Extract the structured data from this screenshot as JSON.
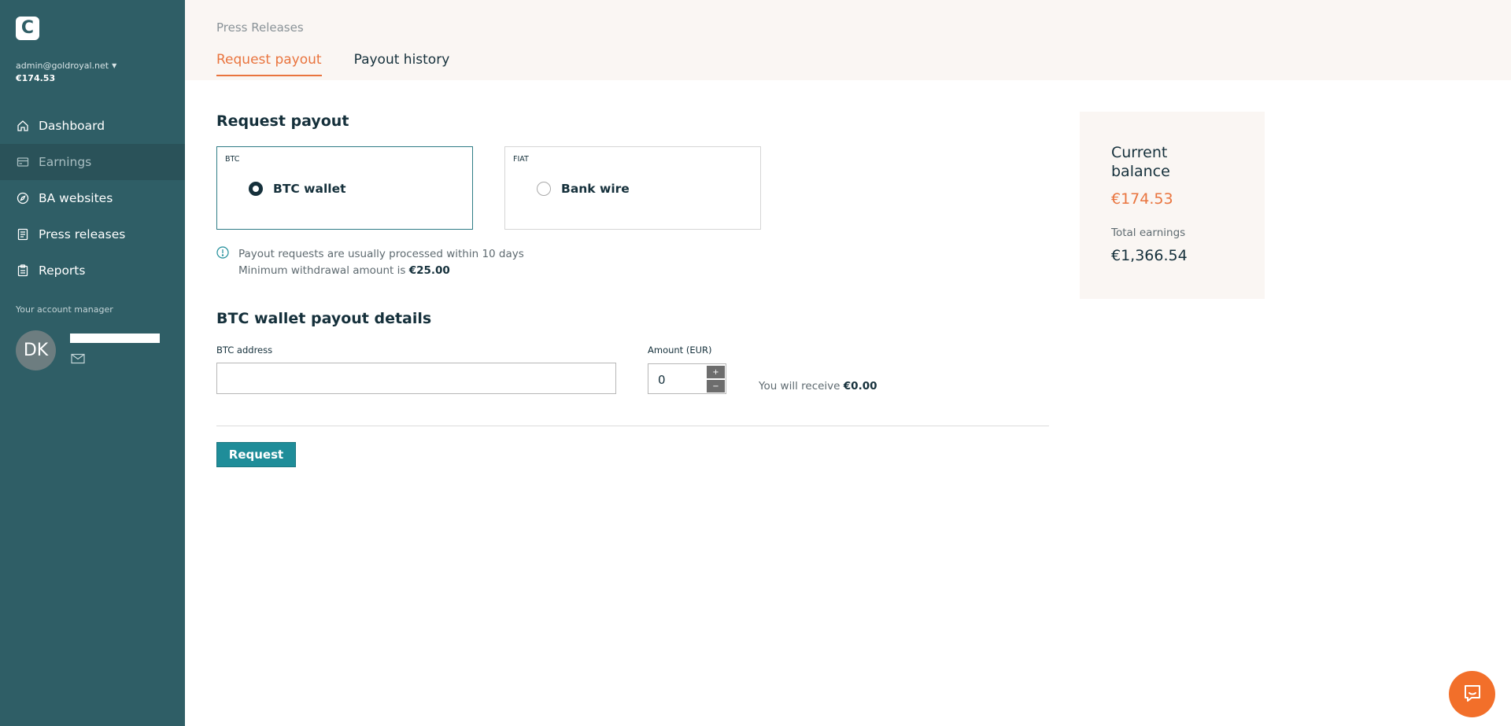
{
  "sidebar": {
    "logo_letter": "C",
    "account": {
      "email": "admin@goldroyal.net",
      "balance": "€174.53"
    },
    "nav": [
      {
        "label": "Dashboard",
        "icon": "home-icon"
      },
      {
        "label": "Earnings",
        "icon": "card-icon",
        "active": true
      },
      {
        "label": "BA websites",
        "icon": "compass-icon"
      },
      {
        "label": "Press releases",
        "icon": "document-icon"
      },
      {
        "label": "Reports",
        "icon": "clipboard-icon"
      }
    ],
    "manager": {
      "label": "Your account manager",
      "initials": "DK"
    }
  },
  "header": {
    "breadcrumb": "Press Releases",
    "tabs": [
      {
        "label": "Request payout",
        "active": true
      },
      {
        "label": "Payout history",
        "active": false
      }
    ]
  },
  "main": {
    "title": "Request payout",
    "options": [
      {
        "tag": "BTC",
        "label": "BTC wallet",
        "selected": true
      },
      {
        "tag": "FIAT",
        "label": "Bank wire",
        "selected": false
      }
    ],
    "info": {
      "line1": "Payout requests are usually processed within 10 days",
      "line2_prefix": "Minimum withdrawal amount is ",
      "line2_amount": "€25.00"
    },
    "details_title": "BTC wallet payout details",
    "btc_address_label": "BTC address",
    "btc_address_value": "",
    "amount_label": "Amount (EUR)",
    "amount_value": "0",
    "stepper_up": "+",
    "stepper_down": "−",
    "receive_prefix": "You will receive ",
    "receive_amount": "€0.00",
    "request_button": "Request"
  },
  "balance": {
    "title": "Current balance",
    "value": "€174.53",
    "total_label": "Total earnings",
    "total_value": "€1,366.54"
  },
  "colors": {
    "sidebar_bg": "#2f5e66",
    "accent_orange": "#e9743e",
    "button_teal": "#1f8d99",
    "chat_orange": "#f26f2a"
  }
}
